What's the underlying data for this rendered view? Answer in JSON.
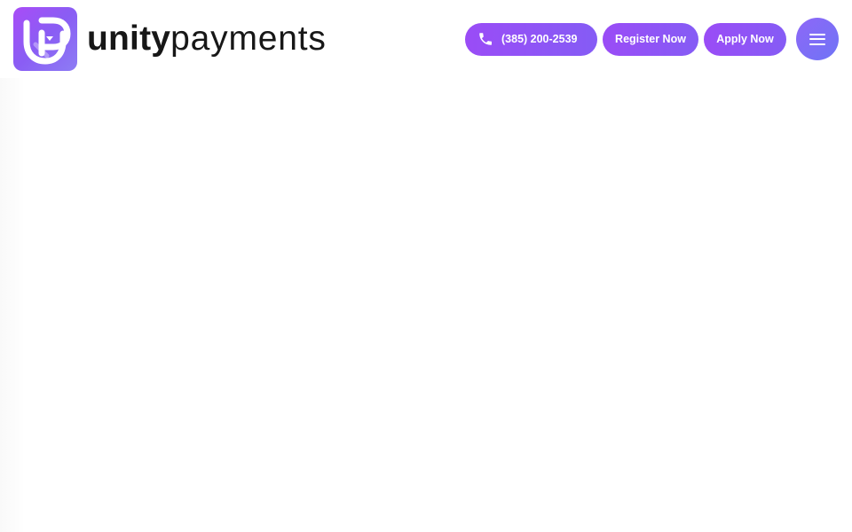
{
  "header": {
    "brand": {
      "name_strong": "unity",
      "name_light": "payments",
      "logo_icon": "unity-payments-logo-icon",
      "logo_colors": [
        "#a94cf7",
        "#7b67f3"
      ]
    },
    "actions": {
      "phone_icon": "phone-icon",
      "phone_label": "(385) 200-2539",
      "register_label": "Register Now",
      "apply_label": "Apply Now",
      "menu_icon": "hamburger-menu-icon"
    }
  },
  "colors": {
    "background": "#ffffff",
    "text": "#171717",
    "button_gradient_start": "#9a4cf6",
    "button_gradient_end": "#855cf5",
    "menu_gradient_start": "#8e67f7",
    "menu_gradient_end": "#6f74f6"
  }
}
